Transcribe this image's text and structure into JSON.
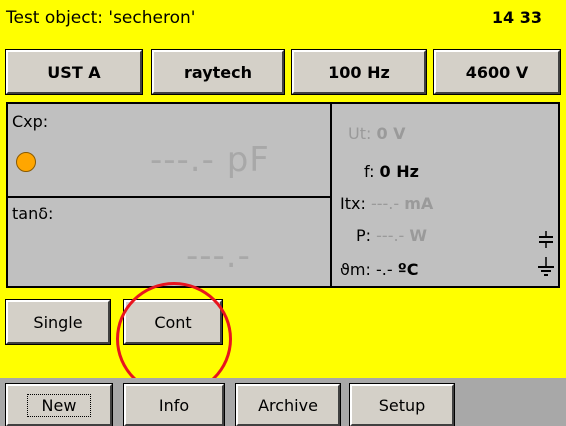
{
  "header": {
    "title": "Test object: 'secheron'",
    "time": "14 33"
  },
  "settings": [
    {
      "label": "UST A"
    },
    {
      "label": "raytech"
    },
    {
      "label": "100 Hz"
    },
    {
      "label": "4600 V"
    }
  ],
  "measurement": {
    "cxp_label": "Cxp:",
    "cxp_value": "---.- pF",
    "tand_label": "tanδ:",
    "tand_value": "---.-",
    "status_color": "#ffa600",
    "ut": {
      "label": "Ut:",
      "value": "0 V"
    },
    "f": {
      "label": "f:",
      "value": "0 Hz"
    },
    "itx": {
      "label": "Itx:",
      "value": "---.-",
      "unit": "mA"
    },
    "p": {
      "label": "P:",
      "value": "---.-",
      "unit": "W"
    },
    "theta": {
      "label": "ϑm:",
      "value": "-.-",
      "unit": "ºC"
    }
  },
  "icons": {
    "capacitor": "capacitor-icon",
    "ground": "ground-icon"
  },
  "modes": {
    "single": "Single",
    "cont": "Cont"
  },
  "highlight_color": "#e8141e",
  "nav": {
    "new": "New",
    "info": "Info",
    "archive": "Archive",
    "setup": "Setup"
  }
}
